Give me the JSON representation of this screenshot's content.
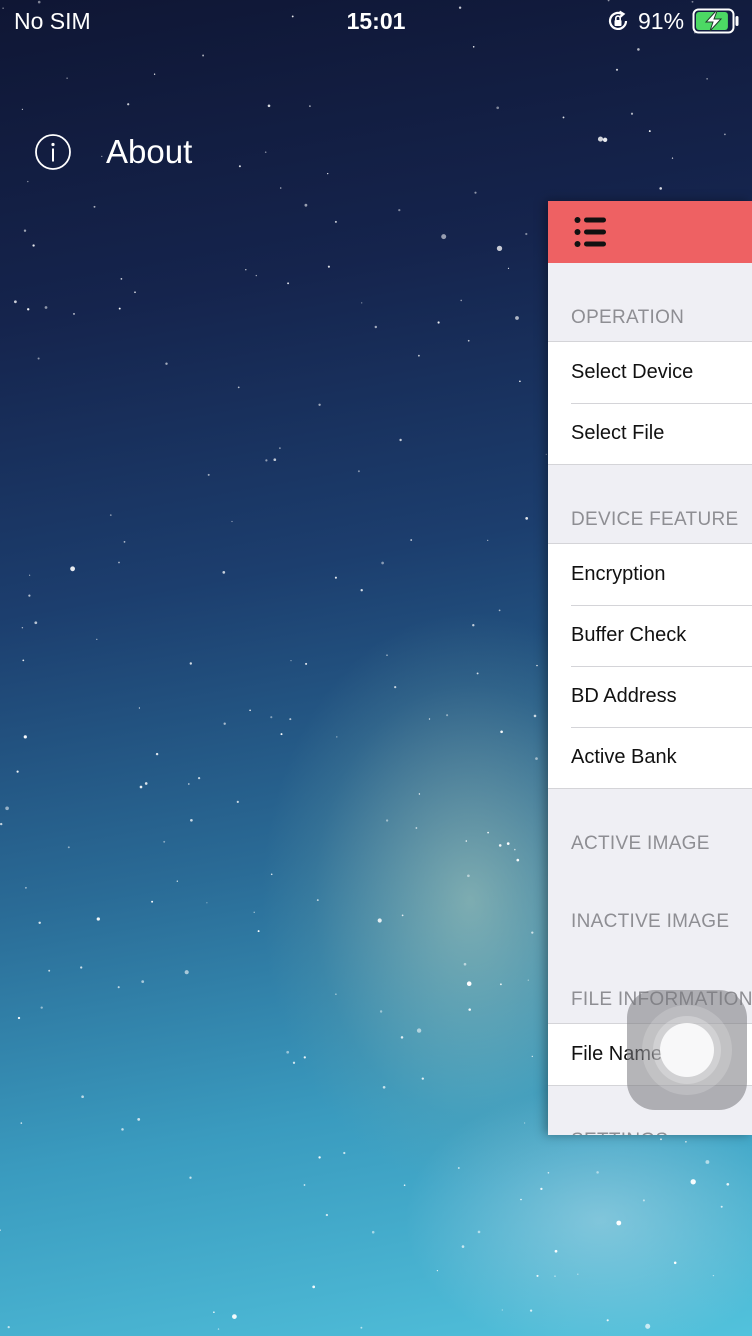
{
  "status_bar": {
    "carrier": "No SIM",
    "time": "15:01",
    "battery_percent": "91%",
    "battery_level": 0.91,
    "icons": [
      "orientation-lock-icon",
      "battery-charging-icon"
    ]
  },
  "about": {
    "label": "About",
    "icon": "info-icon"
  },
  "menu": {
    "accent_color": "#ee6163",
    "header_icon": "hamburger-icon",
    "sections": [
      {
        "title": "OPERATION",
        "items": [
          "Select Device",
          "Select File"
        ]
      },
      {
        "title": "DEVICE FEATURE",
        "items": [
          "Encryption",
          "Buffer Check",
          "BD Address",
          "Active Bank"
        ]
      },
      {
        "title": "ACTIVE IMAGE",
        "items": []
      },
      {
        "title": "INACTIVE IMAGE",
        "items": []
      },
      {
        "title": "FILE INFORMATION",
        "items": [
          "File Name"
        ]
      },
      {
        "title": "SETTINGS",
        "items": []
      }
    ]
  },
  "assistive_touch": {
    "icon": "assistive-touch-icon"
  }
}
